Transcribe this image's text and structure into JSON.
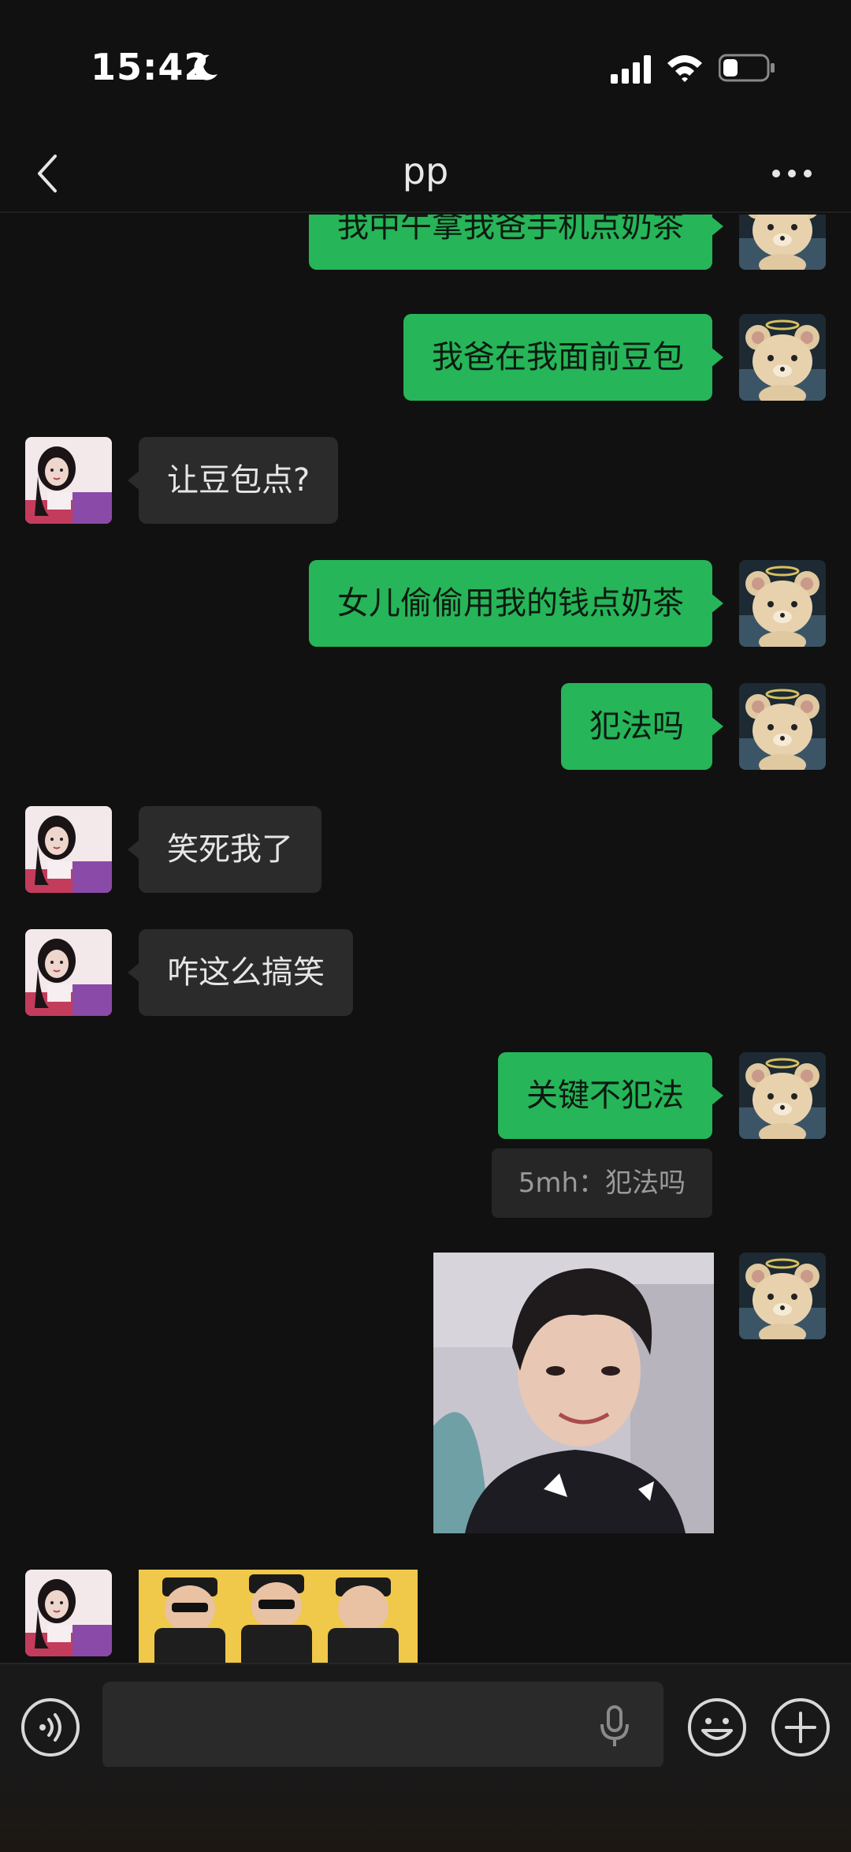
{
  "status_bar": {
    "time": "15:42"
  },
  "nav": {
    "title": "pp"
  },
  "messages": [
    {
      "side": "out",
      "text": "我中午拿我爸手机点奶茶"
    },
    {
      "side": "out",
      "text": "我爸在我面前豆包"
    },
    {
      "side": "in",
      "text": "让豆包点?"
    },
    {
      "side": "out",
      "text": "女儿偷偷用我的钱点奶茶"
    },
    {
      "side": "out",
      "text": "犯法吗"
    },
    {
      "side": "in",
      "text": "笑死我了"
    },
    {
      "side": "in",
      "text": "咋这么搞笑"
    },
    {
      "side": "out",
      "text": "关键不犯法",
      "quote": "5mh：犯法吗"
    }
  ],
  "input": {
    "placeholder": ""
  },
  "colors": {
    "background": "#111111",
    "outgoing_bubble": "#26b558",
    "incoming_bubble": "#2b2b2b",
    "input_bar": "#191919"
  },
  "icons": [
    "moon-icon",
    "signal-icon",
    "wifi-icon",
    "battery-icon",
    "back-icon",
    "more-icon",
    "voice-icon",
    "mic-icon",
    "emoji-icon",
    "plus-icon"
  ]
}
